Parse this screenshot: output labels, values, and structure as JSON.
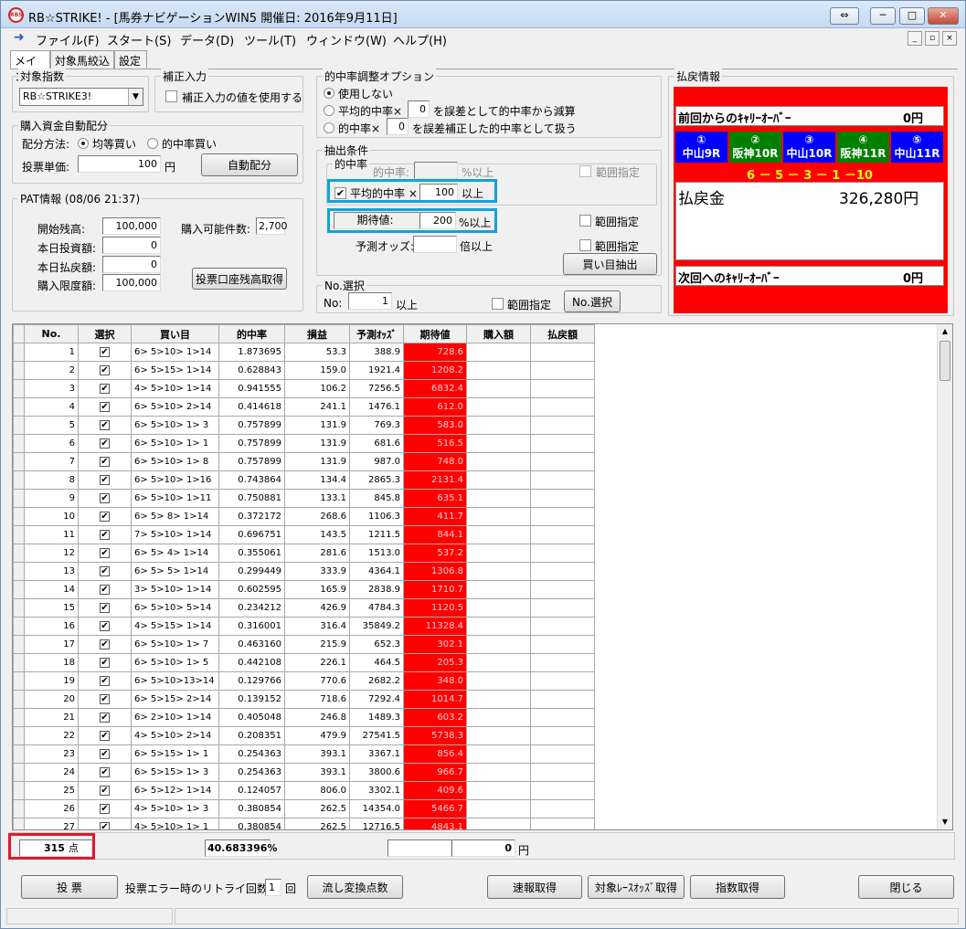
{
  "window": {
    "title": "RB☆STRIKE! - [馬券ナビゲーションWIN5  開催日: 2016年9月11日]",
    "icon_text": "RBS",
    "buttons": {
      "extra": "⇔",
      "minimize": "─",
      "maximize": "□",
      "close": "✕"
    }
  },
  "menu": {
    "items": [
      "ファイル(F)",
      "スタート(S)",
      "データ(D)",
      "ツール(T)",
      "ウィンドウ(W)",
      "ヘルプ(H)"
    ],
    "mdi_buttons": [
      "_",
      "▫",
      "×"
    ]
  },
  "tabs": [
    "メイン",
    "対象馬絞込",
    "設定"
  ],
  "target_index": {
    "title": "対象指数",
    "selected": "RB☆STRIKE3!"
  },
  "correction": {
    "title": "補正入力",
    "checkbox_label": "補正入力の値を使用する"
  },
  "hit_options": {
    "title": "的中率調整オプション",
    "opt1": "使用しない",
    "opt2_prefix": "平均的中率×",
    "opt2_value": "0",
    "opt2_suffix": "を誤差として的中率から減算",
    "opt3_prefix": "的中率×",
    "opt3_value": "0",
    "opt3_suffix": "を誤差補正した的中率として扱う"
  },
  "allocation": {
    "title": "購入資金自動配分",
    "method_label": "配分方法:",
    "opt_equal": "均等買い",
    "opt_hit": "的中率買い",
    "unit_label": "投票単価:",
    "unit_value": "100",
    "unit_suffix": "円",
    "auto_button": "自動配分"
  },
  "pat": {
    "title": "PAT情報 (08/06 21:37)",
    "start_label": "開始残高:",
    "start_value": "100,000",
    "bet_label": "本日投資額:",
    "bet_value": "0",
    "refund_label": "本日払戻額:",
    "refund_value": "0",
    "limit_label": "購入限度額:",
    "limit_value": "100,000",
    "count_label": "購入可能件数:",
    "count_value": "2,700",
    "balance_button": "投票口座残高取得"
  },
  "extract": {
    "title": "抽出条件",
    "hit_rate_group": "的中率",
    "hit_label": "的中率:",
    "hit_suffix": "%以上",
    "range1": "範囲指定",
    "avg_label": "平均的中率 ×",
    "avg_value": "100",
    "avg_suffix": "以上",
    "ev_label": "期待値:",
    "ev_value": "200",
    "ev_suffix": "%以上",
    "range2": "範囲指定",
    "odds_label": "予測オッズ:",
    "odds_suffix": "倍以上",
    "range3": "範囲指定",
    "extract_button": "買い目抽出"
  },
  "no_select": {
    "title": "No.選択",
    "no_label": "No:",
    "no_value": "1",
    "no_suffix": "以上",
    "range": "範囲指定",
    "button": "No.選択"
  },
  "payout": {
    "title": "払戻情報",
    "carry_prev_label": "前回からのｷｬﾘｰｵｰﾊﾞｰ",
    "carry_prev_value": "0円",
    "races": [
      {
        "num": "①",
        "name": "中山9R"
      },
      {
        "num": "②",
        "name": "阪神10R"
      },
      {
        "num": "③",
        "name": "中山10R"
      },
      {
        "num": "④",
        "name": "阪神11R"
      },
      {
        "num": "⑤",
        "name": "中山11R"
      }
    ],
    "result": "6 － 5 － 3 － 1 －10",
    "refund_label": "払戻金",
    "refund_value": "326,280円",
    "carry_next_label": "次回へのｷｬﾘｰｵｰﾊﾞｰ",
    "carry_next_value": "0円",
    "colors": {
      "panel": "#ff0000",
      "blue": "#0000ff",
      "green": "#008000",
      "result_text": "#ffff00"
    }
  },
  "grid": {
    "headers": [
      "No.",
      "選択",
      "買い目",
      "的中率",
      "損益",
      "予測ｵｯｽﾞ",
      "期待値",
      "購入額",
      "払戻額"
    ],
    "rows": [
      [
        "1",
        "6> 5>10> 1>14",
        "1.873695",
        "53.3",
        "388.9",
        "728.6"
      ],
      [
        "2",
        "6> 5>15> 1>14",
        "0.628843",
        "159.0",
        "1921.4",
        "1208.2"
      ],
      [
        "3",
        "4> 5>10> 1>14",
        "0.941555",
        "106.2",
        "7256.5",
        "6832.4"
      ],
      [
        "4",
        "6> 5>10> 2>14",
        "0.414618",
        "241.1",
        "1476.1",
        "612.0"
      ],
      [
        "5",
        "6> 5>10> 1> 3",
        "0.757899",
        "131.9",
        "769.3",
        "583.0"
      ],
      [
        "6",
        "6> 5>10> 1> 1",
        "0.757899",
        "131.9",
        "681.6",
        "516.5"
      ],
      [
        "7",
        "6> 5>10> 1> 8",
        "0.757899",
        "131.9",
        "987.0",
        "748.0"
      ],
      [
        "8",
        "6> 5>10> 1>16",
        "0.743864",
        "134.4",
        "2865.3",
        "2131.4"
      ],
      [
        "9",
        "6> 5>10> 1>11",
        "0.750881",
        "133.1",
        "845.8",
        "635.1"
      ],
      [
        "10",
        "6> 5> 8> 1>14",
        "0.372172",
        "268.6",
        "1106.3",
        "411.7"
      ],
      [
        "11",
        "7> 5>10> 1>14",
        "0.696751",
        "143.5",
        "1211.5",
        "844.1"
      ],
      [
        "12",
        "6> 5> 4> 1>14",
        "0.355061",
        "281.6",
        "1513.0",
        "537.2"
      ],
      [
        "13",
        "6> 5> 5> 1>14",
        "0.299449",
        "333.9",
        "4364.1",
        "1306.8"
      ],
      [
        "14",
        "3> 5>10> 1>14",
        "0.602595",
        "165.9",
        "2838.9",
        "1710.7"
      ],
      [
        "15",
        "6> 5>10> 5>14",
        "0.234212",
        "426.9",
        "4784.3",
        "1120.5"
      ],
      [
        "16",
        "4> 5>15> 1>14",
        "0.316001",
        "316.4",
        "35849.2",
        "11328.4"
      ],
      [
        "17",
        "6> 5>10> 1> 7",
        "0.463160",
        "215.9",
        "652.3",
        "302.1"
      ],
      [
        "18",
        "6> 5>10> 1> 5",
        "0.442108",
        "226.1",
        "464.5",
        "205.3"
      ],
      [
        "19",
        "6> 5>10>13>14",
        "0.129766",
        "770.6",
        "2682.2",
        "348.0"
      ],
      [
        "20",
        "6> 5>15> 2>14",
        "0.139152",
        "718.6",
        "7292.4",
        "1014.7"
      ],
      [
        "21",
        "6> 2>10> 1>14",
        "0.405048",
        "246.8",
        "1489.3",
        "603.2"
      ],
      [
        "22",
        "4> 5>10> 2>14",
        "0.208351",
        "479.9",
        "27541.5",
        "5738.3"
      ],
      [
        "23",
        "6> 5>15> 1> 1",
        "0.254363",
        "393.1",
        "3367.1",
        "856.4"
      ],
      [
        "24",
        "6> 5>15> 1> 3",
        "0.254363",
        "393.1",
        "3800.6",
        "966.7"
      ],
      [
        "25",
        "6> 5>12> 1>14",
        "0.124057",
        "806.0",
        "3302.1",
        "409.6"
      ],
      [
        "26",
        "4> 5>10> 1> 3",
        "0.380854",
        "262.5",
        "14354.0",
        "5466.7"
      ],
      [
        "27",
        "4> 5>10> 1> 1",
        "0.380854",
        "262.5",
        "12716.5",
        "4843.1"
      ]
    ]
  },
  "totals": {
    "count": "315",
    "count_suffix": "点",
    "hit_total": "40.683396%",
    "amount": "0",
    "amount_suffix": "円"
  },
  "footer": {
    "vote_button": "投  票",
    "retry_label": "投票エラー時のリトライ回数:",
    "retry_value": "1",
    "retry_suffix": "回",
    "convert_button": "流し変換点数",
    "quick_button": "速報取得",
    "odds_button": "対象ﾚｰｽｵｯｽﾞ取得",
    "index_button": "指数取得",
    "close_button": "閉じる"
  }
}
